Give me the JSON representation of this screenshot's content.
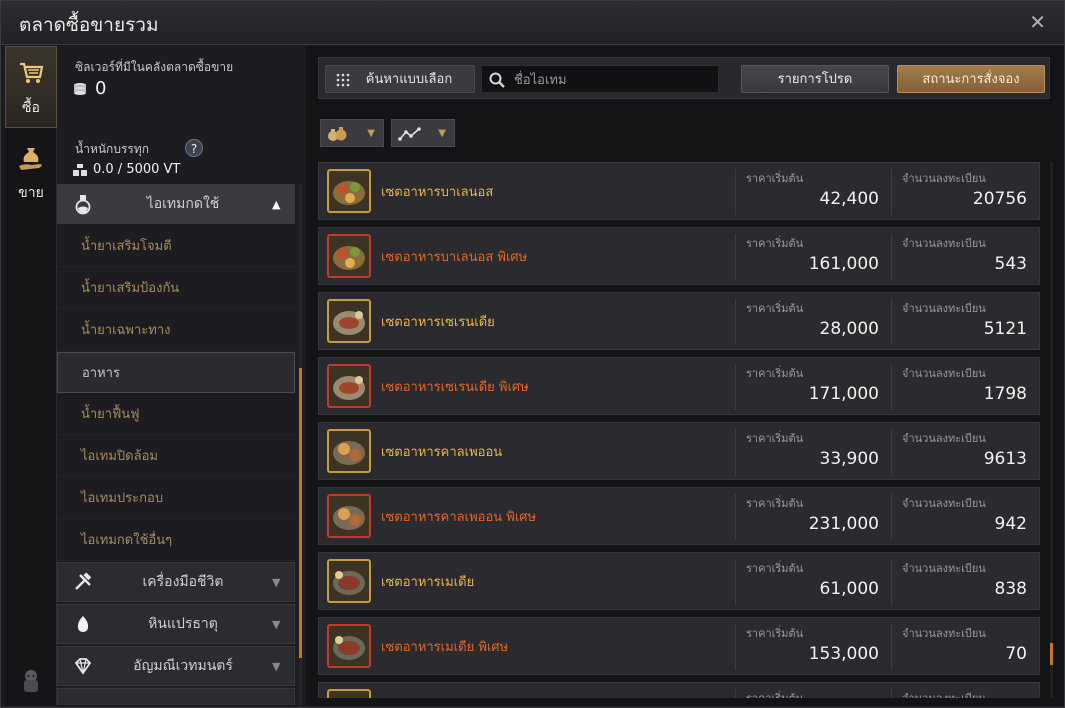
{
  "window": {
    "title": "ตลาดซื้อขายรวม",
    "close_glyph": "✕"
  },
  "tabs": [
    {
      "label": "ซื้อ",
      "icon": "cart-icon",
      "active": true
    },
    {
      "label": "ขาย",
      "icon": "money-bag-hand-icon",
      "active": false
    }
  ],
  "info": {
    "silver_label": "ซิลเวอร์ที่มีในคลังตลาดซื้อขาย",
    "silver_value": "0",
    "weight_label": "น้ำหนักบรรทุก",
    "weight_value": "0.0 / 5000 VT",
    "help_glyph": "?"
  },
  "categories": [
    {
      "label": "ไอเทมกดใช้",
      "icon": "potion-icon",
      "open": true,
      "arrow": "▲",
      "subs": [
        {
          "label": "น้ำยาเสริมโจมตี"
        },
        {
          "label": "น้ำยาเสริมป้องกัน"
        },
        {
          "label": "น้ำยาเฉพาะทาง"
        },
        {
          "label": "อาหาร",
          "selected": true
        },
        {
          "label": "น้ำยาฟื้นฟู"
        },
        {
          "label": "ไอเทมปิดล้อม"
        },
        {
          "label": "ไอเทมประกอบ"
        },
        {
          "label": "ไอเทมกดใช้อื่นๆ"
        }
      ]
    },
    {
      "label": "เครื่องมือชีวิต",
      "icon": "tools-icon",
      "arrow": "▼"
    },
    {
      "label": "หินแปรธาตุ",
      "icon": "egg-stone-icon",
      "arrow": "▼"
    },
    {
      "label": "อัญมณีเวทมนตร์",
      "icon": "diamond-icon",
      "arrow": "▼"
    },
    {
      "label": "",
      "icon": "",
      "arrow": ""
    }
  ],
  "toolbar": {
    "select_search_label": "ค้นหาแบบเลือก",
    "search_placeholder": "ชื่อไอเทม",
    "favorites_label": "รายการโปรด",
    "order_status_label": "สถานะการสั่งจอง"
  },
  "columns": {
    "base_price": "ราคาเริ่มต้น",
    "registered": "จำนวนลงทะเบียน"
  },
  "items": [
    {
      "name": "เซตอาหารบาเลนอส",
      "price": "42,400",
      "count": "20756",
      "special": false
    },
    {
      "name": "เซตอาหารบาเลนอส พิเศษ",
      "price": "161,000",
      "count": "543",
      "special": true
    },
    {
      "name": "เซตอาหารเซเรนเดีย",
      "price": "28,000",
      "count": "5121",
      "special": false
    },
    {
      "name": "เซตอาหารเซเรนเดีย พิเศษ",
      "price": "171,000",
      "count": "1798",
      "special": true
    },
    {
      "name": "เซตอาหารคาลเพออน",
      "price": "33,900",
      "count": "9613",
      "special": false
    },
    {
      "name": "เซตอาหารคาลเพออน พิเศษ",
      "price": "231,000",
      "count": "942",
      "special": true
    },
    {
      "name": "เซตอาหารเมเดีย",
      "price": "61,000",
      "count": "838",
      "special": false
    },
    {
      "name": "เซตอาหารเมเดีย พิเศษ",
      "price": "153,000",
      "count": "70",
      "special": true
    },
    {
      "name": "",
      "price": "",
      "count": "",
      "special": false
    }
  ],
  "colors": {
    "normal_item": "#e7b84a",
    "special_item": "#e0682a",
    "accent": "#c8771f",
    "order_button": "#a47c4a"
  }
}
